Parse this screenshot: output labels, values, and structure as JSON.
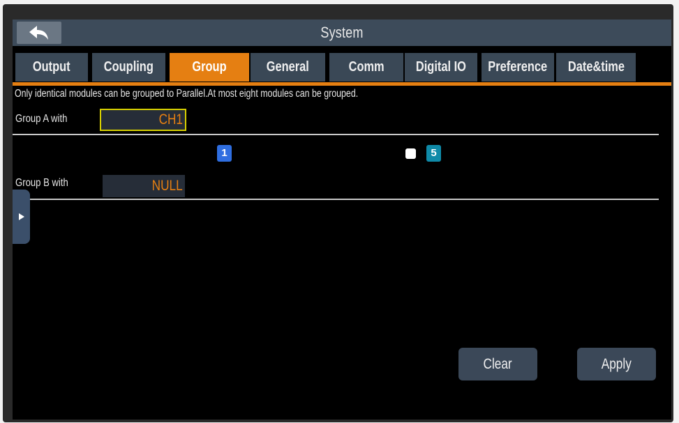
{
  "title": "System",
  "tabs": [
    {
      "label": "Output",
      "active": false
    },
    {
      "label": "Coupling",
      "active": false
    },
    {
      "label": "Group",
      "active": true
    },
    {
      "label": "General",
      "active": false
    },
    {
      "label": "Comm",
      "active": false
    },
    {
      "label": "Digital IO",
      "active": false
    },
    {
      "label": "Preference",
      "active": false
    },
    {
      "label": "Date&time",
      "active": false
    }
  ],
  "note": "Only identical modules can be grouped to Parallel.At most eight modules can be grouped.",
  "group_a": {
    "label": "Group A with",
    "value": "CH1"
  },
  "modules": [
    {
      "label": "1",
      "color": "#2f6ee0"
    },
    {
      "label": "5",
      "color": "#0f8aa8",
      "checked": false
    }
  ],
  "group_b": {
    "label": "Group B with",
    "value": "NULL"
  },
  "buttons": {
    "clear": "Clear",
    "apply": "Apply"
  },
  "colors": {
    "accent": "#e57f12",
    "selection_border": "#d7d000",
    "panel": "#3a4856",
    "background": "#000000"
  },
  "icons": {
    "back": "back-arrow-icon",
    "side_handle": "expand-right-icon"
  }
}
